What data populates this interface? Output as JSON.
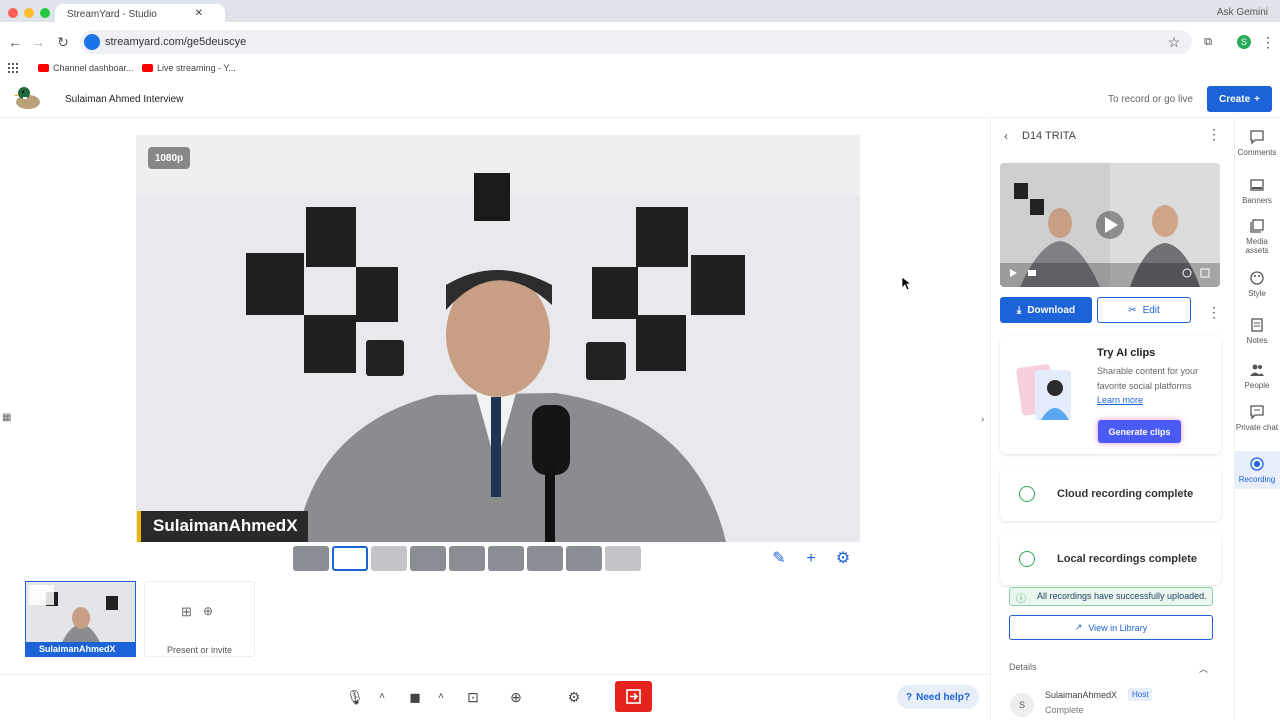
{
  "browser": {
    "tab_title": "StreamYard - Studio",
    "url": "streamyard.com/ge5deuscye",
    "ask_gemini": "Ask Gemini",
    "bookmarks": [
      {
        "label": "Channel dashboar..."
      },
      {
        "label": "Live streaming - Y..."
      }
    ],
    "profile_initial": "S"
  },
  "header": {
    "title": "Sulaiman Ahmed Interview",
    "record_hint": "To record or go live",
    "create_label": "Create"
  },
  "stage": {
    "resolution": "1080p",
    "name_tag": "SulaimanAhmedX"
  },
  "participants": {
    "thumb_name": "SulaimanAhmedX",
    "invite_label": "Present or invite"
  },
  "bottom": {
    "need_help": "Need help?"
  },
  "panel": {
    "title": "D14 TRITA",
    "download_label": "Download",
    "edit_label": "Edit",
    "ai_clips": {
      "title": "Try AI clips",
      "desc": "Sharable content for your favorite social platforms",
      "learn_more": "Learn more",
      "generate_label": "Generate clips"
    },
    "cloud_status": "Cloud recording complete",
    "local_status": "Local recordings complete",
    "upload_alert": "All recordings have successfully uploaded.",
    "library_label": "View in Library",
    "details_label": "Details",
    "host": {
      "initial": "S",
      "name": "SulaimanAhmedX",
      "badge": "Host",
      "status": "Complete"
    }
  },
  "sidebar": {
    "items": [
      {
        "label": "Comments",
        "icon": "comments-icon"
      },
      {
        "label": "Banners",
        "icon": "banners-icon"
      },
      {
        "label": "Media assets",
        "icon": "media-assets-icon"
      },
      {
        "label": "Style",
        "icon": "palette-icon"
      },
      {
        "label": "Notes",
        "icon": "notes-icon"
      },
      {
        "label": "People",
        "icon": "people-icon"
      },
      {
        "label": "Private chat",
        "icon": "private-chat-icon"
      },
      {
        "label": "Recording",
        "icon": "recording-icon",
        "active": true
      }
    ]
  },
  "colors": {
    "accent": "#1d63d8",
    "leave": "#e5251d",
    "success": "#2aaa5a"
  }
}
